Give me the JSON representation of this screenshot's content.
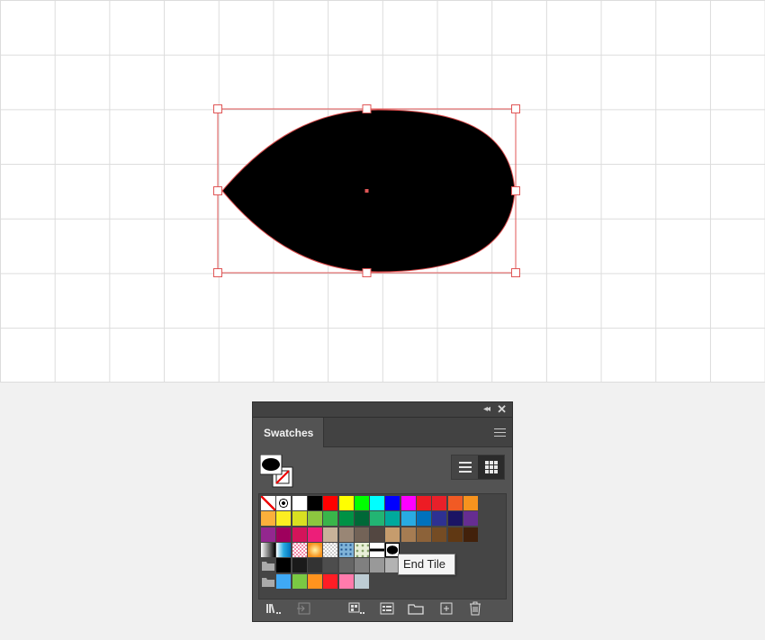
{
  "panel": {
    "tab_label": "Swatches",
    "tooltip": "End Tile"
  },
  "swatch_rows": [
    [
      "none",
      "registration",
      "#ffffff",
      "#000000",
      "#ff0000",
      "#ffff00",
      "#00ff00",
      "#00ffff",
      "#0000ff",
      "#ff00ff",
      "#ed1c24",
      "#e8202a",
      "#f15a24",
      "#f7931e"
    ],
    [
      "#fbb03b",
      "#fcee21",
      "#d9e021",
      "#8cc63f",
      "#39b54a",
      "#009245",
      "#006837",
      "#22b573",
      "#00a99d",
      "#29abe2",
      "#0071bc",
      "#2e3192",
      "#1b1464",
      "#662d91"
    ],
    [
      "#93278f",
      "#9e005d",
      "#d4145a",
      "#ed1e79",
      "#c7b299",
      "#998675",
      "#736357",
      "#534741",
      "#c69c6d",
      "#a67c52",
      "#8c6239",
      "#754c24",
      "#603813",
      "#42210b"
    ],
    [
      "grad-bw",
      "grad-blue",
      "pattern-check-pink",
      "grad-orange",
      "pattern-check",
      "pattern-blue",
      "pattern-leaf",
      "end-tile-1",
      "end-tile-2"
    ],
    [
      "folder",
      "#000000",
      "#1a1a1a",
      "#333333",
      "#4d4d4d",
      "#666666",
      "#808080",
      "#999999",
      "#b3b3b3"
    ],
    [
      "folder",
      "#3fa9f5",
      "#7ac943",
      "#ff931e",
      "#ff1d25",
      "#ff7bac",
      "#bdccd4"
    ]
  ],
  "icons": {
    "close": "close-icon",
    "collapse": "collapse-arrows-icon",
    "menu": "panel-menu-icon"
  }
}
